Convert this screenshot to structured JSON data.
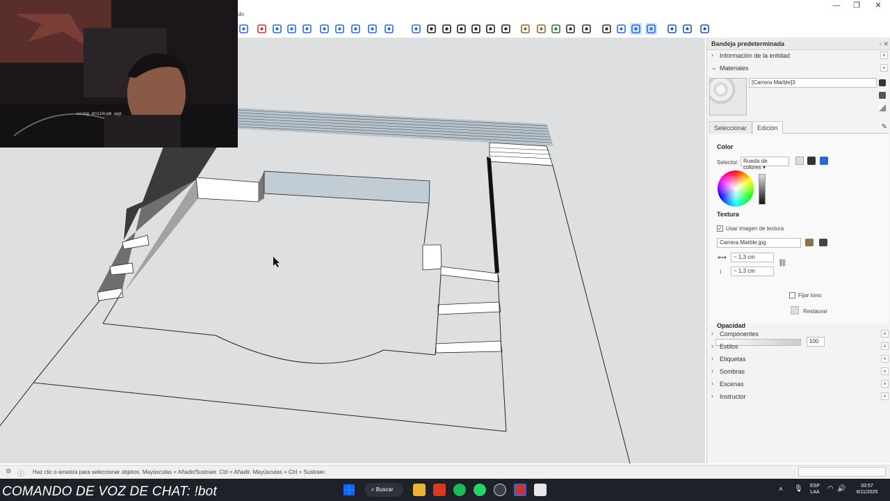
{
  "window": {
    "title_fragment": "do",
    "controls": [
      "—",
      "❐",
      "✕"
    ]
  },
  "toolbar": {
    "icons": [
      "circle-select-icon",
      "move-icon",
      "rotate-icon",
      "zoom-icon",
      "zoom-extents-icon",
      "orbit-icon",
      "section-icon",
      "layers-icon",
      "sandbox-icon",
      "user-icon",
      "iso-view-icon",
      "top-view-icon",
      "front-view-icon",
      "right-view-icon",
      "back-view-icon",
      "left-view-icon",
      "bottom-view-icon",
      "box-icon",
      "warehouse-icon",
      "paint-icon",
      "geo-icon",
      "section-cut-icon",
      "position-camera-icon",
      "walk-icon",
      "look-around-icon",
      "xray-icon",
      "sandbox-grid-icon",
      "sandbox-smoove-icon",
      "stamp-icon",
      "drape-icon",
      "add-detail-icon",
      "flip-edge-icon",
      "outliner-icon",
      "extension-icon"
    ]
  },
  "panel": {
    "title": "Bandeja predeterminada",
    "entity_info": "Información de la entidad",
    "materials": "Materiales",
    "material_name": "[Carrera Marble]3",
    "tab_select": "Seleccionar",
    "tab_edit": "Edición",
    "color_label": "Color",
    "selector_label": "Selector:",
    "selector_value": "Rueda de colores",
    "texture_label": "Textura",
    "use_texture_label": "Usar imagen de textura",
    "texture_file": "Carrera Marble.jpg",
    "width_value": "~ 1,3 cm",
    "height_value": "~ 1,3 cm",
    "fix_tone_label": "Fijar tono",
    "restore_label": "Restaurar",
    "opacity_label": "Opacidad",
    "opacity_value": "100",
    "collapsed_trays": [
      "Componentes",
      "Estilos",
      "Etiquetas",
      "Sombras",
      "Escenas",
      "Instructor"
    ]
  },
  "status": {
    "hint": "Haz clic o arrastra para seleccionar objetos. Mayúsculas = Añadir/Sustraer. Ctrl = Añadir. Mayúsculas + Ctrl = Sustraer."
  },
  "overlay": {
    "chat_command": "COMANDO DE VOZ DE CHAT: !bot",
    "webcam_caption": "using droidcam app"
  },
  "taskbar": {
    "search_label": "Buscar",
    "language": "ESP",
    "region": "LAA",
    "time": "03:57",
    "date": "6/11/2025"
  },
  "colors": {
    "viewport_bg": "#dedfe0",
    "wall_blue": "#c2ccd4",
    "taskbar_bg": "#1f2128",
    "active_tool_bg": "#cde4f7"
  }
}
